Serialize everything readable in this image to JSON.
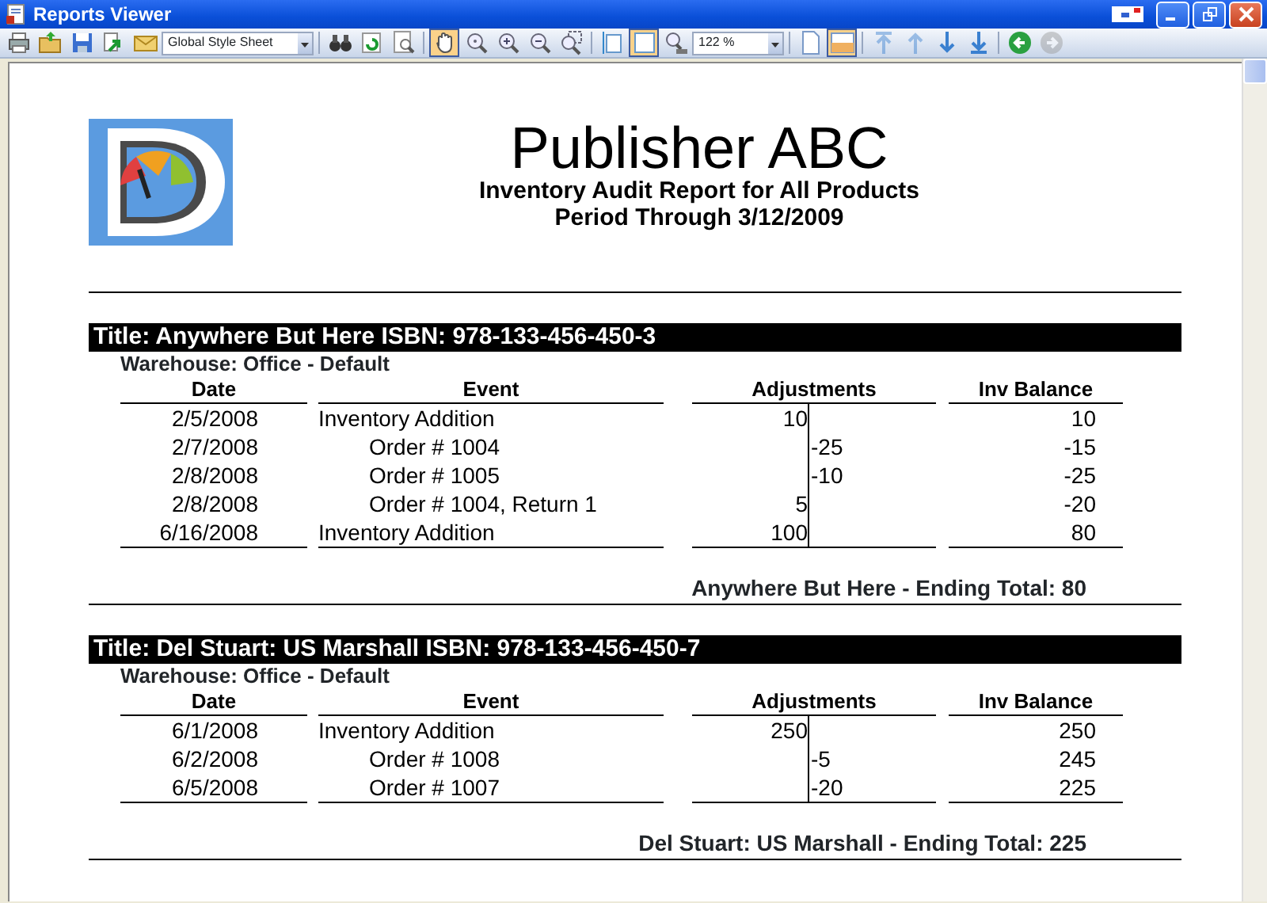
{
  "window": {
    "title": "Reports Viewer"
  },
  "toolbar": [
    {
      "kind": "button",
      "pressed": false,
      "disabled": false
    },
    {
      "kind": "button",
      "pressed": false,
      "disabled": false
    },
    {
      "kind": "button",
      "pressed": false,
      "disabled": false
    },
    {
      "kind": "button",
      "pressed": false,
      "disabled": false
    },
    {
      "kind": "button",
      "pressed": false,
      "disabled": false
    },
    {
      "kind": "dropdown",
      "value": "Global Style Sheet"
    },
    {
      "kind": "separator"
    },
    {
      "kind": "button",
      "pressed": false,
      "disabled": false
    },
    {
      "kind": "button",
      "pressed": false,
      "disabled": false
    },
    {
      "kind": "button",
      "pressed": false,
      "disabled": false
    },
    {
      "kind": "separator"
    },
    {
      "kind": "button",
      "pressed": true,
      "disabled": false
    },
    {
      "kind": "button",
      "pressed": false,
      "disabled": false
    },
    {
      "kind": "button",
      "pressed": false,
      "disabled": false
    },
    {
      "kind": "button",
      "pressed": false,
      "disabled": false
    },
    {
      "kind": "button",
      "pressed": false,
      "disabled": false
    },
    {
      "kind": "separator"
    },
    {
      "kind": "button",
      "pressed": false,
      "disabled": false
    },
    {
      "kind": "button",
      "pressed": true,
      "disabled": false
    },
    {
      "kind": "button",
      "pressed": false,
      "disabled": false
    },
    {
      "kind": "dropdown",
      "value": "122 %"
    },
    {
      "kind": "separator"
    },
    {
      "kind": "button",
      "pressed": false,
      "disabled": false
    },
    {
      "kind": "button",
      "pressed": true,
      "disabled": false
    },
    {
      "kind": "separator"
    },
    {
      "kind": "button",
      "pressed": false,
      "disabled": true
    },
    {
      "kind": "button",
      "pressed": false,
      "disabled": true
    },
    {
      "kind": "button",
      "pressed": false,
      "disabled": false
    },
    {
      "kind": "button",
      "pressed": false,
      "disabled": false
    },
    {
      "kind": "separator"
    },
    {
      "kind": "button",
      "pressed": false,
      "disabled": false
    },
    {
      "kind": "button",
      "pressed": false,
      "disabled": true
    }
  ],
  "report": {
    "title": "Publisher ABC",
    "subtitle": "Inventory Audit Report for All Products",
    "period": "Period Through 3/12/2009",
    "sections": [
      {
        "heading": "Title: Anywhere But Here ISBN: 978-133-456-450-3",
        "warehouse": "Warehouse: Office - Default",
        "columns": [
          "Date",
          "Event",
          "Adjustments",
          "Inv Balance"
        ],
        "rows": [
          {
            "date": "2/5/2008",
            "event": "Inventory Addition",
            "kind": "addition",
            "increase": "10",
            "balance": "10"
          },
          {
            "date": "2/7/2008",
            "event": "Order # 1004",
            "kind": "order",
            "decrease": "-25",
            "balance": "-15"
          },
          {
            "date": "2/8/2008",
            "event": "Order # 1005",
            "kind": "order",
            "decrease": "-10",
            "balance": "-25"
          },
          {
            "date": "2/8/2008",
            "event": "Order # 1004, Return 1",
            "kind": "order",
            "increase": "5",
            "balance": "-20"
          },
          {
            "date": "6/16/2008",
            "event": "Inventory Addition",
            "kind": "addition",
            "increase": "100",
            "balance": "80"
          }
        ],
        "total": "Anywhere But Here - Ending Total: 80"
      },
      {
        "heading": "Title: Del Stuart: US Marshall ISBN: 978-133-456-450-7",
        "warehouse": "Warehouse: Office - Default",
        "columns": [
          "Date",
          "Event",
          "Adjustments",
          "Inv Balance"
        ],
        "rows": [
          {
            "date": "6/1/2008",
            "event": "Inventory Addition",
            "kind": "addition",
            "increase": "250",
            "balance": "250"
          },
          {
            "date": "6/2/2008",
            "event": "Order # 1008",
            "kind": "order",
            "decrease": "-5",
            "balance": "245"
          },
          {
            "date": "6/5/2008",
            "event": "Order # 1007",
            "kind": "order",
            "decrease": "-20",
            "balance": "225"
          }
        ],
        "total": "Del Stuart: US Marshall - Ending Total: 225"
      }
    ]
  }
}
